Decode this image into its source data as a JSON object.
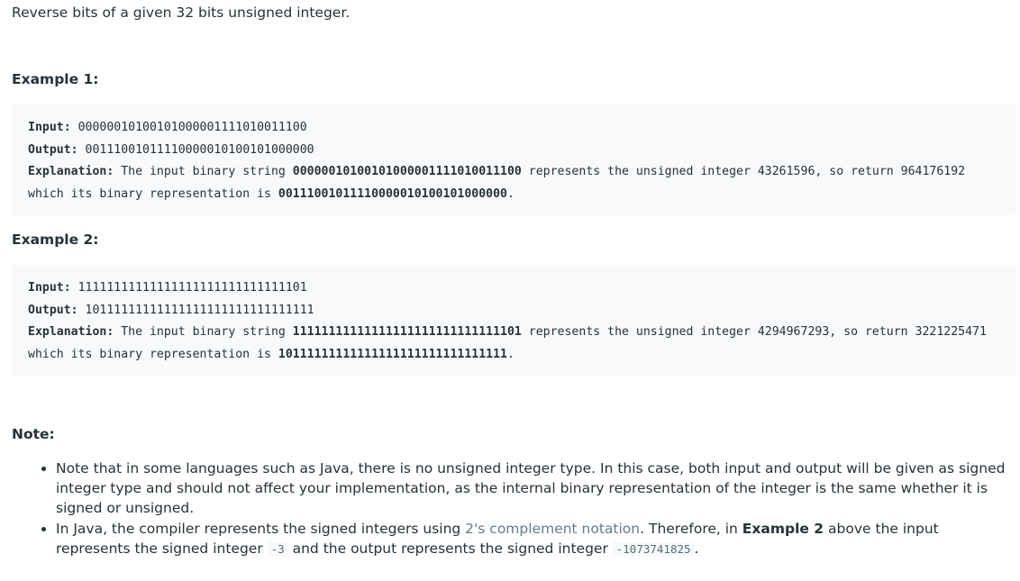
{
  "intro": "Reverse bits of a given 32 bits unsigned integer.",
  "example1": {
    "heading": "Example 1:",
    "input_label": "Input:",
    "input_value": " 00000010100101000001111010011100",
    "output_label": "Output:",
    "output_value": " 00111001011110000010100101000000",
    "explanation_label": "Explanation:",
    "expl_part1": " The input binary string ",
    "expl_bold1": "00000010100101000001111010011100",
    "expl_part2": " represents the unsigned integer 43261596, so return 964176192 which its binary representation is ",
    "expl_bold2": "00111001011110000010100101000000",
    "expl_part3": "."
  },
  "example2": {
    "heading": "Example 2:",
    "input_label": "Input:",
    "input_value": " 11111111111111111111111111111101",
    "output_label": "Output:",
    "output_value": " 10111111111111111111111111111111",
    "explanation_label": "Explanation:",
    "expl_part1": " The input binary string ",
    "expl_bold1": "11111111111111111111111111111101",
    "expl_part2": " represents the unsigned integer 4294967293, so return 3221225471 which its binary representation is ",
    "expl_bold2": "10111111111111111111111111111111",
    "expl_part3": "."
  },
  "note": {
    "heading": "Note:",
    "item1": "Note that in some languages such as Java, there is no unsigned integer type. In this case, both input and output will be given as signed integer type and should not affect your implementation, as the internal binary representation of the integer is the same whether it is signed or unsigned.",
    "item2_part1": "In Java, the compiler represents the signed integers using ",
    "item2_link": "2's complement notation",
    "item2_part2": ". Therefore, in ",
    "item2_bold": "Example 2",
    "item2_part3": " above the input represents the signed integer ",
    "item2_code1": "-3",
    "item2_part4": " and the output represents the signed integer ",
    "item2_code2": "-1073741825",
    "item2_part5": "."
  }
}
